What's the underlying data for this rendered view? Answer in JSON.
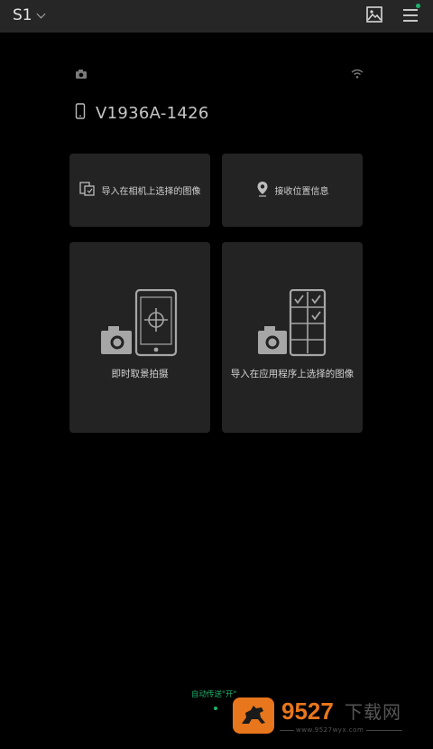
{
  "topbar": {
    "camera_name": "S1",
    "icons": [
      "chevron-down-icon",
      "gallery-icon",
      "menu-icon"
    ]
  },
  "status": {
    "icons": [
      "camera-icon",
      "wifi-icon"
    ]
  },
  "device": {
    "name": "V1936A-1426",
    "icon": "phone-icon"
  },
  "tiles": {
    "import_camera_selected": "导入在相机上选择的图像",
    "receive_location": "接收位置信息",
    "remote_shooting": "即时取景拍摄",
    "import_app_selected": "导入在应用程序上选择的图像"
  },
  "footer": {
    "auto_transfer": "自动传送\"开\""
  },
  "watermark": {
    "number": "9527",
    "site_name": "下载网",
    "url": "www.9527wyx.com"
  },
  "colors": {
    "background": "#000000",
    "topbar": "#262626",
    "tile": "#232323",
    "accent_green": "#1db36e",
    "watermark_orange": "#e8761c"
  }
}
